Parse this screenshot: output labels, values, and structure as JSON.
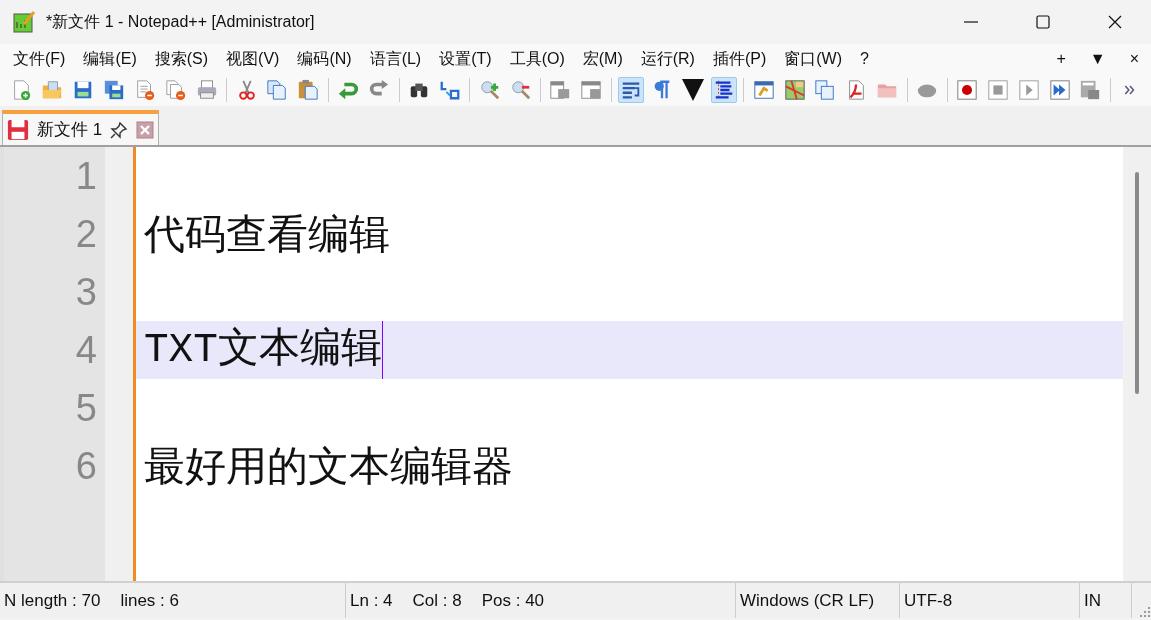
{
  "window": {
    "title": "*新文件 1 - Notepad++ [Administrator]"
  },
  "menu": [
    "文件(F)",
    "编辑(E)",
    "搜索(S)",
    "视图(V)",
    "编码(N)",
    "语言(L)",
    "设置(T)",
    "工具(O)",
    "宏(M)",
    "运行(R)",
    "插件(P)",
    "窗口(W)",
    "?"
  ],
  "menu_extras": [
    "+",
    "▼",
    "×"
  ],
  "toolbar": {
    "word_wrap_on": true,
    "indent_guide_on": true
  },
  "tabs": [
    {
      "label": "新文件 1",
      "selected": true,
      "modified": true
    }
  ],
  "editor": {
    "lines": [
      {
        "number": "1",
        "current": false
      },
      {
        "number": "2",
        "text": "代码查看编辑",
        "current": false
      },
      {
        "number": "3",
        "current": false
      },
      {
        "number": "4",
        "text": "TXT文本编辑",
        "current": true
      },
      {
        "number": "5",
        "current": false
      },
      {
        "number": "6",
        "text": "最好用的文本编辑器",
        "current": false
      }
    ]
  },
  "status_bar": [
    {
      "items": [
        "N length : 70",
        "lines : 6"
      ]
    },
    {
      "items": [
        "Ln : 4",
        "Col : 8",
        "Pos : 40"
      ]
    },
    {
      "items": [
        "Windows (CR LF)"
      ]
    },
    {
      "items": [
        "UTF-8"
      ]
    },
    {
      "items": [
        "IN"
      ]
    }
  ]
}
